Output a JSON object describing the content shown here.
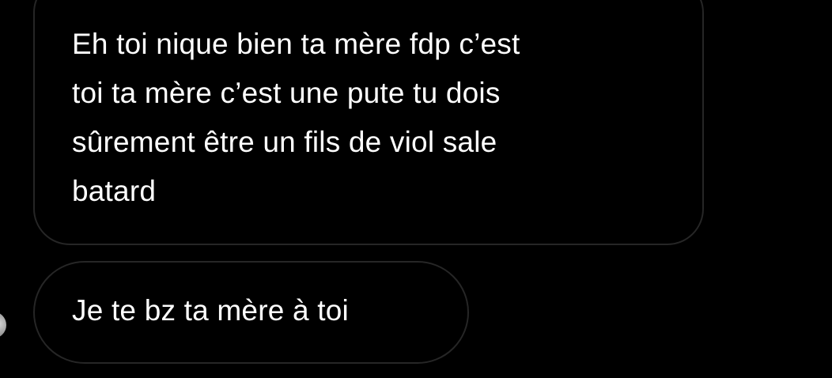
{
  "conversation": {
    "messages": [
      {
        "text": "Eh toi nique bien ta mère fdp c’est\ntoi ta mère c’est une pute tu dois\nsûrement être un fils de viol sale\nbatard"
      },
      {
        "text": "Je te bz ta mère à toi"
      }
    ]
  },
  "colors": {
    "background": "#000000",
    "bubble_border": "#262626",
    "text": "#ffffff"
  }
}
